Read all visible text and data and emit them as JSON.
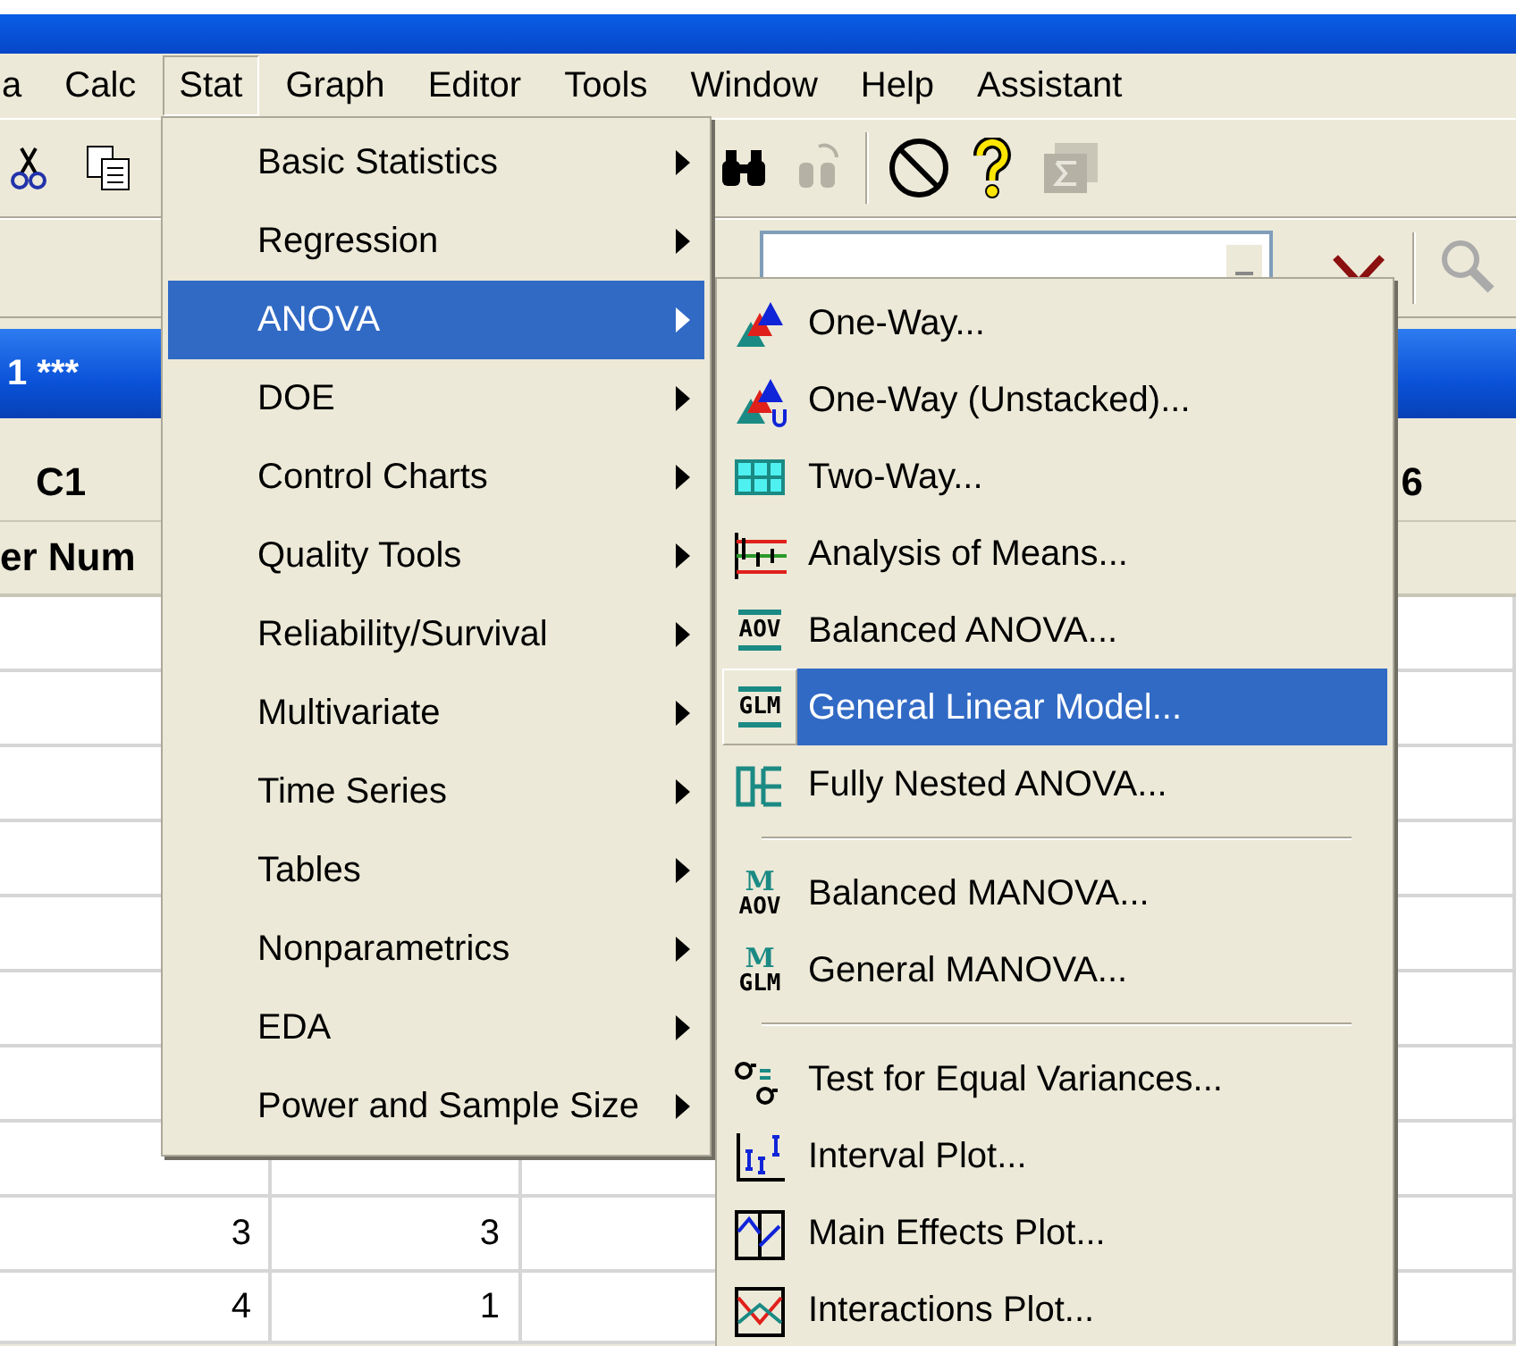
{
  "menu_bar": [
    {
      "label": "a",
      "selected": false
    },
    {
      "label": "Calc",
      "selected": false
    },
    {
      "label": "Stat",
      "selected": true
    },
    {
      "label": "Graph",
      "selected": false
    },
    {
      "label": "Editor",
      "selected": false
    },
    {
      "label": "Tools",
      "selected": false
    },
    {
      "label": "Window",
      "selected": false
    },
    {
      "label": "Help",
      "selected": false
    },
    {
      "label": "Assistant",
      "selected": false
    }
  ],
  "worksheet": {
    "title": "1 ***",
    "columns": [
      "C1",
      "6"
    ],
    "column_name": "er Num",
    "rows": [
      [
        "3",
        "3"
      ],
      [
        "4",
        "1"
      ]
    ]
  },
  "stat_menu": [
    {
      "label": "Basic Statistics",
      "selected": false
    },
    {
      "label": "Regression",
      "selected": false
    },
    {
      "label": "ANOVA",
      "selected": true
    },
    {
      "label": "DOE",
      "selected": false
    },
    {
      "label": "Control Charts",
      "selected": false
    },
    {
      "label": "Quality Tools",
      "selected": false
    },
    {
      "label": "Reliability/Survival",
      "selected": false
    },
    {
      "label": "Multivariate",
      "selected": false
    },
    {
      "label": "Time Series",
      "selected": false
    },
    {
      "label": "Tables",
      "selected": false
    },
    {
      "label": "Nonparametrics",
      "selected": false
    },
    {
      "label": "EDA",
      "selected": false
    },
    {
      "label": "Power and Sample Size",
      "selected": false
    }
  ],
  "anova_submenu": [
    {
      "kind": "item",
      "label": "One-Way...",
      "selected": false
    },
    {
      "kind": "item",
      "label": "One-Way (Unstacked)...",
      "selected": false
    },
    {
      "kind": "item",
      "label": "Two-Way...",
      "selected": false
    },
    {
      "kind": "item",
      "label": "Analysis of Means...",
      "selected": false
    },
    {
      "kind": "item",
      "label": "Balanced ANOVA...",
      "selected": false,
      "icon_lines": [
        "AOV"
      ]
    },
    {
      "kind": "item",
      "label": "General Linear Model...",
      "selected": true,
      "icon_lines": [
        "GLM"
      ]
    },
    {
      "kind": "item",
      "label": "Fully Nested ANOVA...",
      "selected": false
    },
    {
      "kind": "separator"
    },
    {
      "kind": "item",
      "label": "Balanced MANOVA...",
      "selected": false,
      "icon_lines": [
        "M",
        "AOV"
      ]
    },
    {
      "kind": "item",
      "label": "General MANOVA...",
      "selected": false,
      "icon_lines": [
        "M",
        "GLM"
      ]
    },
    {
      "kind": "separator"
    },
    {
      "kind": "item",
      "label": "Test for Equal Variances...",
      "selected": false
    },
    {
      "kind": "item",
      "label": "Interval Plot...",
      "selected": false
    },
    {
      "kind": "item",
      "label": "Main Effects Plot...",
      "selected": false
    },
    {
      "kind": "item",
      "label": "Interactions Plot...",
      "selected": false
    }
  ]
}
